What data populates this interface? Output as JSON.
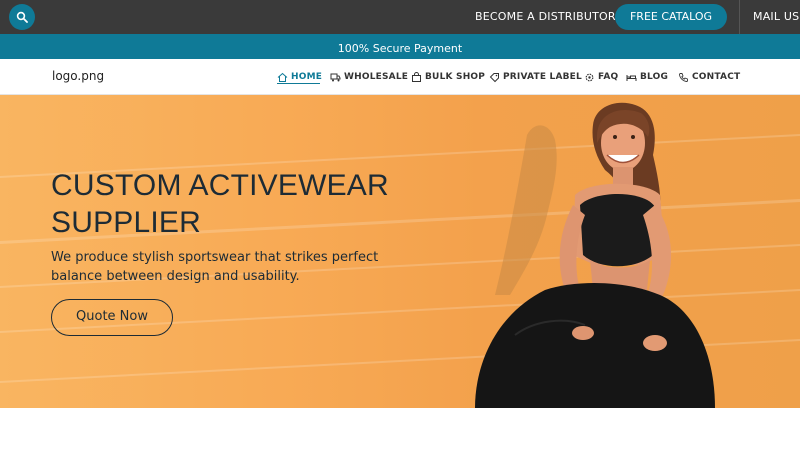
{
  "topbar": {
    "distributor_label": "BECOME A DISTRIBUTOR",
    "catalog_label": "FREE CATALOG",
    "mail_label": "MAIL US",
    "background": "#3a3a3a",
    "accent": "#0f7a97"
  },
  "securebar": {
    "text": "100% Secure Payment"
  },
  "nav": {
    "logo": "logo.png",
    "items": [
      {
        "label": "HOME",
        "icon": "home-icon"
      },
      {
        "label": "WHOLESALE",
        "icon": "truck-icon"
      },
      {
        "label": "BULK SHOP",
        "icon": "bag-icon"
      },
      {
        "label": "PRIVATE LABEL",
        "icon": "tag-icon"
      },
      {
        "label": "FAQ",
        "icon": "gear-icon"
      },
      {
        "label": "BLOG",
        "icon": "bed-icon"
      },
      {
        "label": "CONTACT",
        "icon": "phone-icon"
      }
    ]
  },
  "hero": {
    "title": "CUSTOM ACTIVEWEAR SUPPLIER",
    "subtitle": "We produce stylish sportswear that strikes perfect balance between design and usability.",
    "cta_label": "Quote Now"
  }
}
